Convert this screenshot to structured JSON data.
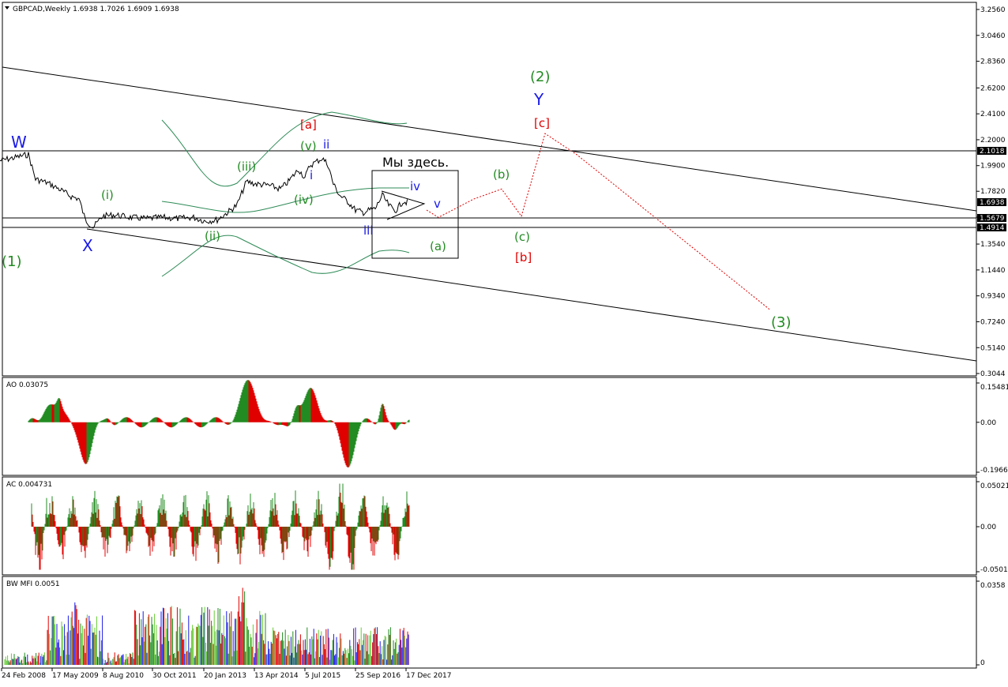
{
  "header": {
    "symbol_line": "GBPCAD,Weekly  1.6938 1.7026 1.6909 1.6938",
    "ao_label": "AO 0.03075",
    "ac_label": "AC 0.004731",
    "mfi_label": "BW MFI 0.0051",
    "annotation_box": "Мы здесь."
  },
  "colors": {
    "green": "#228B22",
    "red": "#E00000",
    "blue": "#1A1AE6",
    "ma": "#2E8B57"
  },
  "chart_data": [
    {
      "type": "line",
      "name": "main",
      "ylim": [
        0.3044,
        3.256
      ],
      "y_ticks": [
        "3.2560",
        "3.0460",
        "2.8360",
        "2.6200",
        "2.4100",
        "2.2000",
        "1.9900",
        "1.7820",
        "1.5720",
        "1.3540",
        "1.1440",
        "0.9340",
        "0.7240",
        "0.5140",
        "0.3044"
      ],
      "price_marks": [
        "2.1018",
        "1.6938",
        "1.5679",
        "1.4914"
      ],
      "x_ticks": [
        "24 Feb 2008",
        "17 May 2009",
        "8 Aug 2010",
        "30 Oct 2011",
        "20 Jan 2013",
        "13 Apr 2014",
        "5 Jul 2015",
        "25 Sep 2016",
        "17 Dec 2017"
      ],
      "price_path": [
        [
          0,
          2.03
        ],
        [
          15,
          2.05
        ],
        [
          36,
          2.08
        ],
        [
          45,
          1.88
        ],
        [
          60,
          1.85
        ],
        [
          75,
          1.8
        ],
        [
          90,
          1.74
        ],
        [
          100,
          1.72
        ],
        [
          108,
          1.55
        ],
        [
          118,
          1.49
        ],
        [
          130,
          1.58
        ],
        [
          145,
          1.59
        ],
        [
          165,
          1.57
        ],
        [
          185,
          1.56
        ],
        [
          205,
          1.57
        ],
        [
          225,
          1.56
        ],
        [
          245,
          1.57
        ],
        [
          260,
          1.54
        ],
        [
          275,
          1.55
        ],
        [
          290,
          1.62
        ],
        [
          300,
          1.67
        ],
        [
          312,
          1.86
        ],
        [
          325,
          1.84
        ],
        [
          340,
          1.83
        ],
        [
          355,
          1.8
        ],
        [
          365,
          1.86
        ],
        [
          378,
          1.96
        ],
        [
          386,
          1.89
        ],
        [
          392,
          1.99
        ],
        [
          400,
          2.02
        ],
        [
          408,
          2.05
        ],
        [
          415,
          2.0
        ],
        [
          422,
          1.84
        ],
        [
          430,
          1.75
        ],
        [
          440,
          1.7
        ],
        [
          450,
          1.63
        ],
        [
          460,
          1.61
        ],
        [
          468,
          1.63
        ],
        [
          475,
          1.64
        ],
        [
          484,
          1.75
        ],
        [
          492,
          1.67
        ],
        [
          500,
          1.62
        ],
        [
          510,
          1.7
        ],
        [
          517,
          1.69
        ]
      ],
      "forecast_path": [
        [
          540,
          1.63
        ],
        [
          555,
          1.57
        ],
        [
          600,
          1.72
        ],
        [
          635,
          1.8
        ],
        [
          660,
          1.58
        ],
        [
          690,
          2.25
        ],
        [
          730,
          2.08
        ],
        [
          975,
          0.82
        ]
      ],
      "wave_labels": [
        {
          "text": "W",
          "color": "blue"
        },
        {
          "text": "X",
          "color": "blue"
        },
        {
          "text": "(1)",
          "color": "green"
        },
        {
          "text": "(i)",
          "color": "green"
        },
        {
          "text": "(ii)",
          "color": "green"
        },
        {
          "text": "(iii)",
          "color": "green"
        },
        {
          "text": "(iv)",
          "color": "green"
        },
        {
          "text": "(v)",
          "color": "green"
        },
        {
          "text": "[a]",
          "color": "red"
        },
        {
          "text": "i",
          "color": "blue"
        },
        {
          "text": "ii",
          "color": "blue"
        },
        {
          "text": "iii",
          "color": "blue"
        },
        {
          "text": "iv",
          "color": "blue"
        },
        {
          "text": "v",
          "color": "blue"
        },
        {
          "text": "(a)",
          "color": "green"
        },
        {
          "text": "(b)",
          "color": "green"
        },
        {
          "text": "(c)",
          "color": "green"
        },
        {
          "text": "[b]",
          "color": "red"
        },
        {
          "text": "(2)",
          "color": "green"
        },
        {
          "text": "Y",
          "color": "blue"
        },
        {
          "text": "[c]",
          "color": "red"
        },
        {
          "text": "(3)",
          "color": "green"
        }
      ]
    },
    {
      "type": "bar",
      "name": "AO",
      "ylim": [
        -0.19667,
        0.15481
      ],
      "y_ticks": [
        "0.15481",
        "0.00",
        "-0.19667"
      ]
    },
    {
      "type": "bar",
      "name": "AC",
      "ylim": [
        -0.05019,
        0.05021
      ],
      "y_ticks": [
        "0.050211",
        "0.00",
        "-0.05019"
      ]
    },
    {
      "type": "bar",
      "name": "BW MFI",
      "ylim": [
        0,
        0.0358
      ],
      "y_ticks": [
        "0.0358",
        "0"
      ]
    }
  ]
}
